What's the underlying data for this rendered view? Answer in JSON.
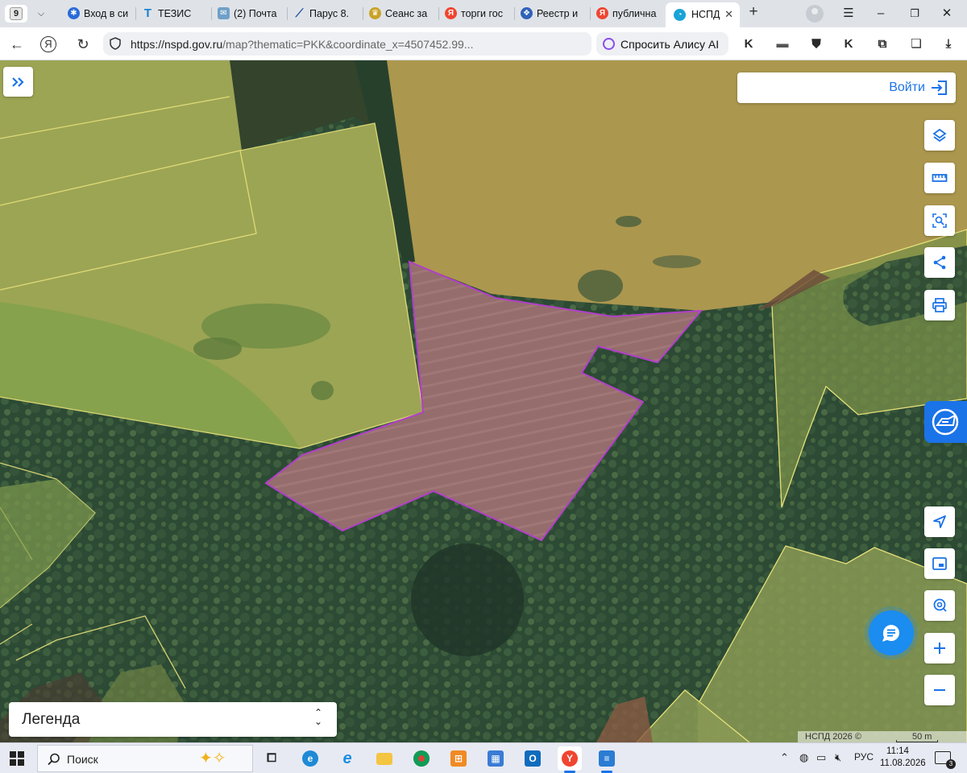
{
  "browser": {
    "tab_count": "9",
    "tabs": [
      {
        "label": "Вход в си",
        "icon": "gosuslugi-icon",
        "color": "#2a6ad8"
      },
      {
        "label": "ТЕЗИС",
        "icon": "tezis-icon",
        "color": "#1d80d0"
      },
      {
        "label": "(2) Почта",
        "icon": "mail-icon",
        "color": "#6fa0c8"
      },
      {
        "label": "Парус 8.",
        "icon": "parus-icon",
        "color": "#1d4f9a"
      },
      {
        "label": "Сеанс за",
        "icon": "gerb-icon",
        "color": "#c9a227"
      },
      {
        "label": "торги гос",
        "icon": "yandex-icon",
        "color": "#f04530"
      },
      {
        "label": "Реестр и",
        "icon": "rosreestr-icon",
        "color": "#2f62b8"
      },
      {
        "label": "публична",
        "icon": "yandex-icon",
        "color": "#f04530"
      },
      {
        "label": "НСПД",
        "icon": "nspd-icon",
        "color": "#19a3d6"
      }
    ],
    "new_tab_label": "+",
    "url_host": "https://nspd.gov.ru",
    "url_rest": "/map?thematic=PKK&coordinate_x=4507452.99...",
    "alice_label": "Спросить Алису AI"
  },
  "map": {
    "login_label": "Войти",
    "legend_label": "Легенда",
    "copyright": "НСПД 2026 ©",
    "scale_label": "50 m",
    "controls": [
      {
        "name": "layers-icon"
      },
      {
        "name": "ruler-icon"
      },
      {
        "name": "area-search-icon"
      },
      {
        "name": "share-icon"
      },
      {
        "name": "print-icon"
      }
    ],
    "colors": {
      "selected_parcel": "#b23fc9",
      "parcel_border": "#e6e07a",
      "accent": "#1b73e8"
    }
  },
  "taskbar": {
    "search_label": "Поиск",
    "language": "РУС",
    "time": "11:14",
    "date": "11.08.2026",
    "notifications": "3",
    "apps": [
      {
        "name": "task-view-icon"
      },
      {
        "name": "edge-icon"
      },
      {
        "name": "ie-icon"
      },
      {
        "name": "explorer-icon"
      },
      {
        "name": "chrome-icon"
      },
      {
        "name": "app-grid-icon"
      },
      {
        "name": "store-icon"
      },
      {
        "name": "outlook-icon"
      },
      {
        "name": "yandex-browser-icon"
      },
      {
        "name": "document-icon"
      }
    ]
  }
}
